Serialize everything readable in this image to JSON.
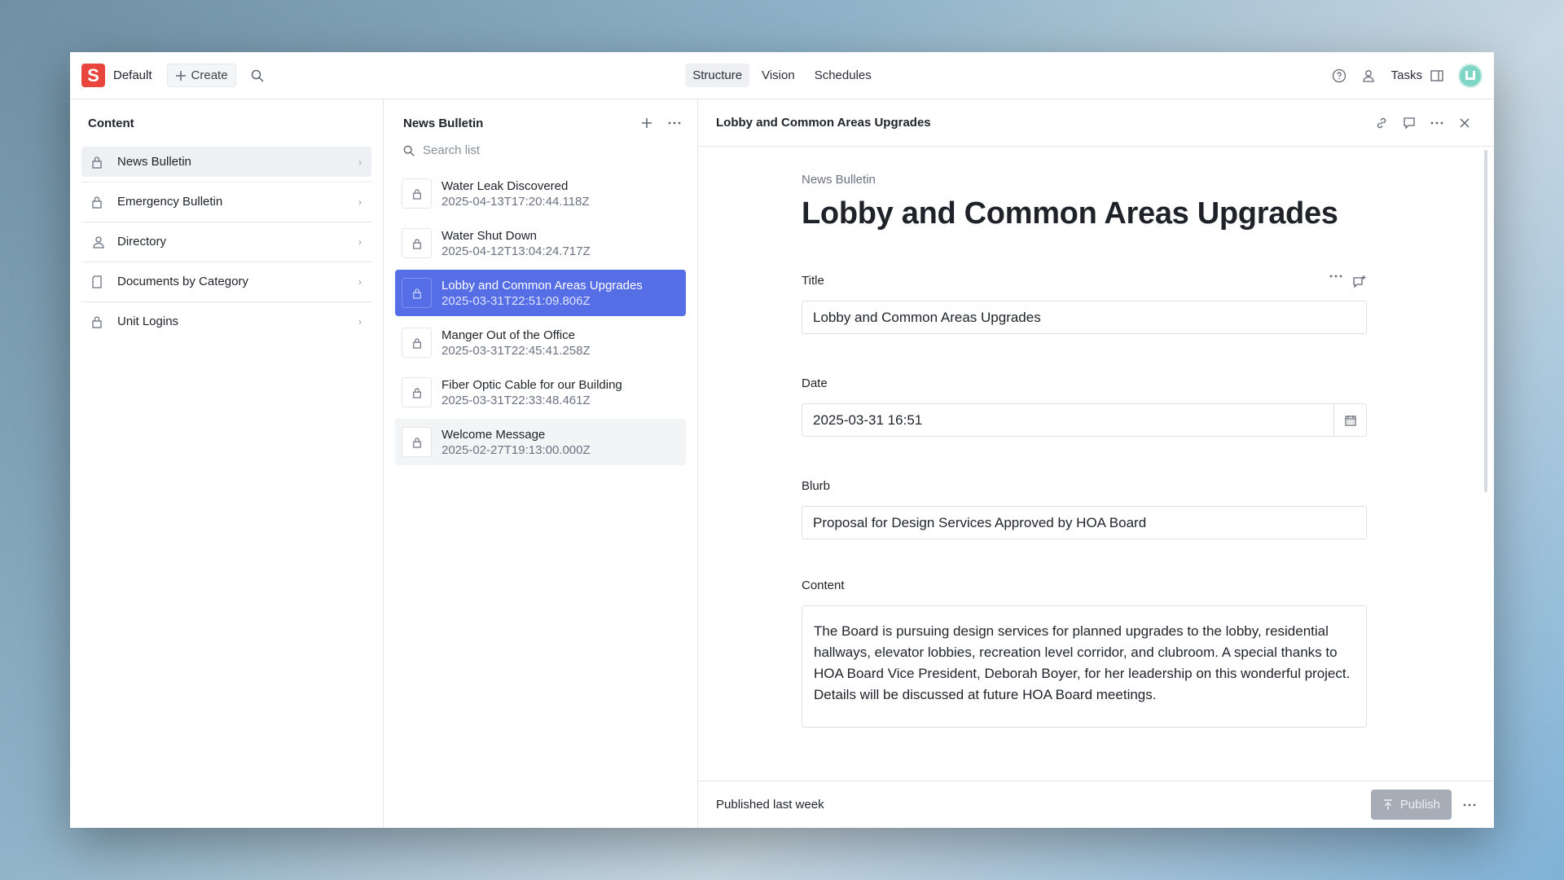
{
  "topnav": {
    "workspace": "Default",
    "create_label": "Create",
    "tabs": [
      "Structure",
      "Vision",
      "Schedules"
    ],
    "active_tab": "Structure",
    "tasks_label": "Tasks",
    "logo_letter": "S"
  },
  "content_pane": {
    "title": "Content",
    "items": [
      {
        "label": "News Bulletin",
        "icon": "lock-icon"
      },
      {
        "label": "Emergency Bulletin",
        "icon": "lock-icon"
      },
      {
        "label": "Directory",
        "icon": "users-icon"
      },
      {
        "label": "Documents by Category",
        "icon": "document-icon"
      },
      {
        "label": "Unit Logins",
        "icon": "lock-icon"
      }
    ]
  },
  "list_pane": {
    "title": "News Bulletin",
    "search_placeholder": "Search list",
    "items": [
      {
        "title": "Water Leak Discovered",
        "date": "2025-04-13T17:20:44.118Z"
      },
      {
        "title": "Water Shut Down",
        "date": "2025-04-12T13:04:24.717Z"
      },
      {
        "title": "Lobby and Common Areas Upgrades",
        "date": "2025-03-31T22:51:09.806Z"
      },
      {
        "title": "Manger Out of the Office",
        "date": "2025-03-31T22:45:41.258Z"
      },
      {
        "title": "Fiber Optic Cable for our Building",
        "date": "2025-03-31T22:33:48.461Z"
      },
      {
        "title": "Welcome Message",
        "date": "2025-02-27T19:13:00.000Z"
      }
    ]
  },
  "document": {
    "header_title": "Lobby and Common Areas Upgrades",
    "type_label": "News Bulletin",
    "heading": "Lobby and Common Areas Upgrades",
    "fields": {
      "title_label": "Title",
      "title_value": "Lobby and Common Areas Upgrades",
      "date_label": "Date",
      "date_value": "2025-03-31 16:51",
      "blurb_label": "Blurb",
      "blurb_value": "Proposal for Design Services Approved by HOA Board",
      "content_label": "Content",
      "content_value": "The Board is pursuing design services for planned upgrades to the lobby, residential hallways, elevator lobbies, recreation level corridor, and clubroom.  A special thanks to HOA Board Vice President, Deborah Boyer, for her leadership on this wonderful project. Details will be discussed at future HOA Board meetings."
    },
    "footer_status": "Published last week",
    "publish_label": "Publish"
  },
  "colors": {
    "accent": "#556ee6",
    "logo": "#e8453c"
  }
}
